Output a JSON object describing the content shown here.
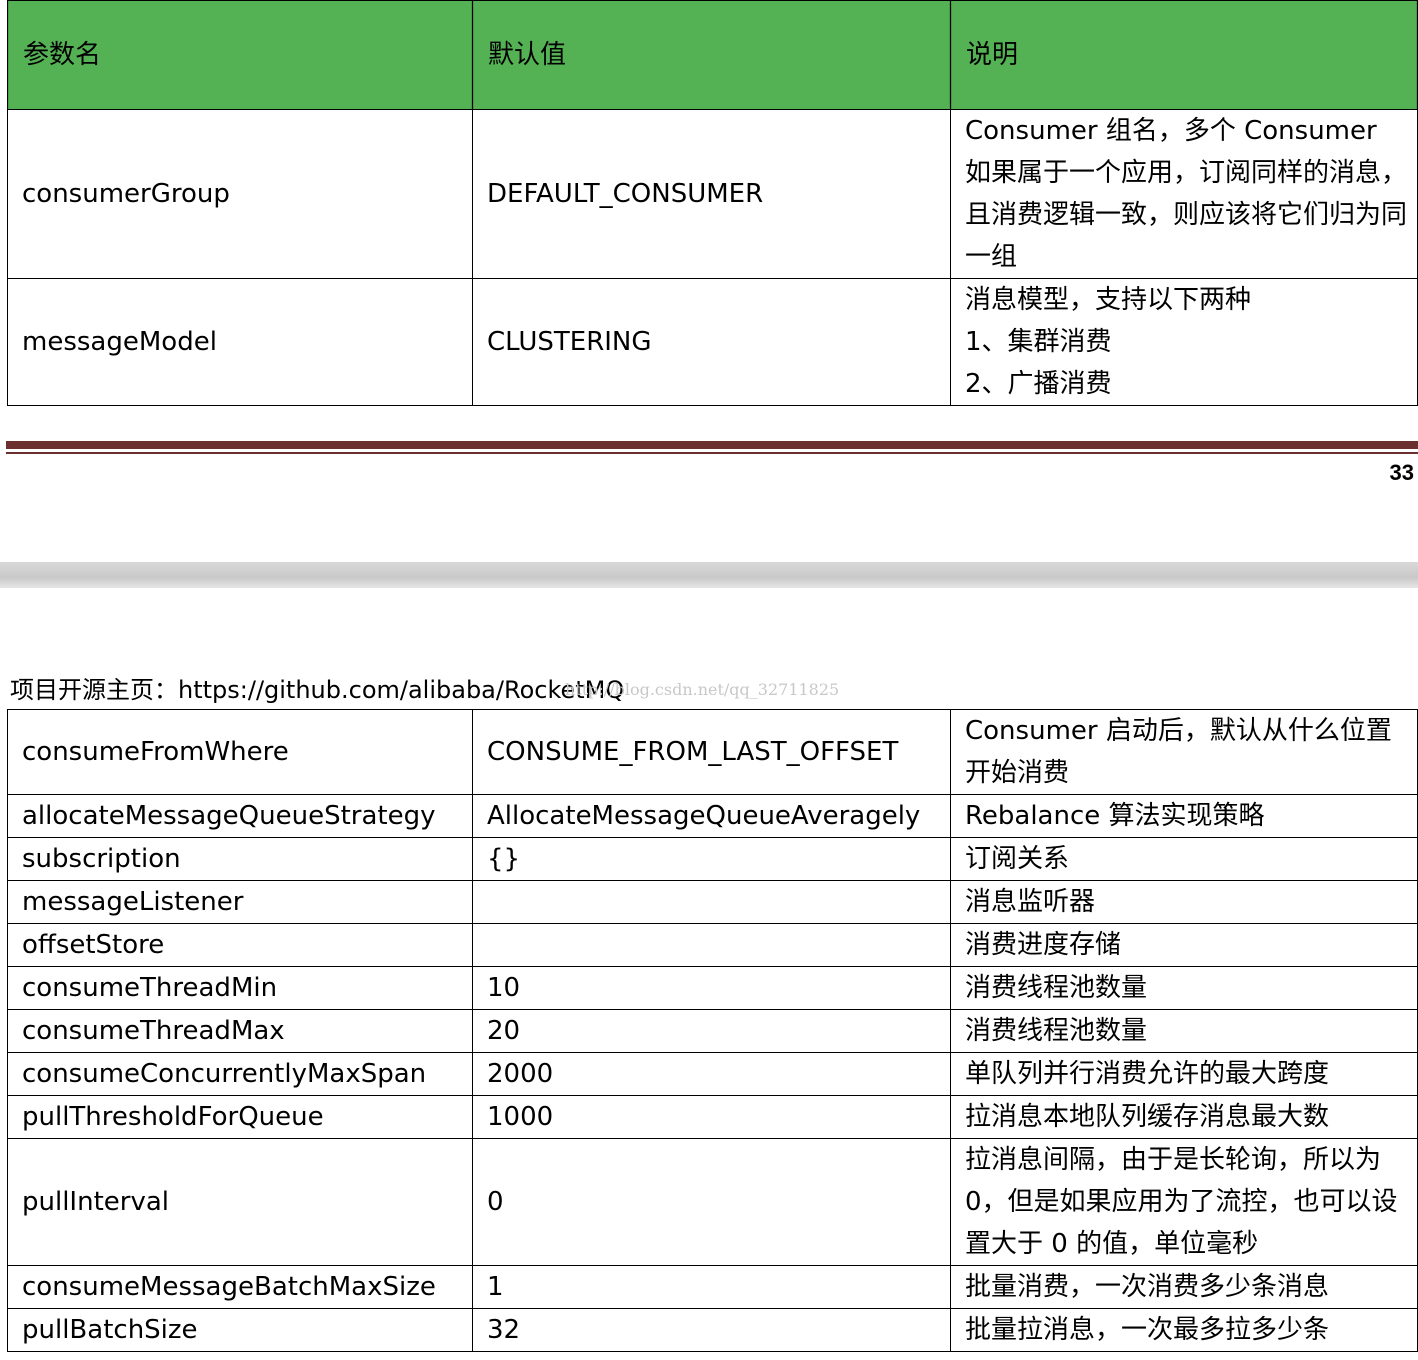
{
  "top_table": {
    "header": {
      "param": "参数名",
      "default": "默认值",
      "desc": "说明"
    },
    "rows": [
      {
        "param": "consumerGroup",
        "default": "DEFAULT_CONSUMER",
        "desc": "Consumer 组名，多个 Consumer 如果属于一个应用，订阅同样的消息，且消费逻辑一致，则应该将它们归为同一组"
      },
      {
        "param": "messageModel",
        "default": "CLUSTERING",
        "desc_lines": [
          "消息模型，支持以下两种",
          "1、集群消费",
          "2、广播消费"
        ]
      }
    ]
  },
  "page_number": "33",
  "header_line": "项目开源主页：https://github.com/alibaba/RocketMQ",
  "watermark": "http://blog.csdn.net/qq_32711825",
  "bottom_table": {
    "rows": [
      {
        "param": "consumeFromWhere",
        "default": "CONSUME_FROM_LAST_OFFSET",
        "desc": "Consumer 启动后，默认从什么位置开始消费"
      },
      {
        "param": "allocateMessageQueueStrategy",
        "default": "AllocateMessageQueueAveragely",
        "desc": "Rebalance 算法实现策略"
      },
      {
        "param": "subscription",
        "default": "{}",
        "desc": "订阅关系"
      },
      {
        "param": "messageListener",
        "default": "",
        "desc": "消息监听器"
      },
      {
        "param": "offsetStore",
        "default": "",
        "desc": "消费进度存储"
      },
      {
        "param": "consumeThreadMin",
        "default": "10",
        "desc": "消费线程池数量"
      },
      {
        "param": "consumeThreadMax",
        "default": "20",
        "desc": "消费线程池数量"
      },
      {
        "param": "consumeConcurrentlyMaxSpan",
        "default": "2000",
        "desc": "单队列并行消费允许的最大跨度"
      },
      {
        "param": "pullThresholdForQueue",
        "default": "1000",
        "desc": "拉消息本地队列缓存消息最大数"
      },
      {
        "param": "pullInterval",
        "default": "0",
        "desc": "拉消息间隔，由于是长轮询，所以为 0，但是如果应用为了流控，也可以设置大于 0 的值，单位毫秒"
      },
      {
        "param": "consumeMessageBatchMaxSize",
        "default": "1",
        "desc": "批量消费，一次消费多少条消息"
      },
      {
        "param": "pullBatchSize",
        "default": "32",
        "desc": "批量拉消息，一次最多拉多少条"
      }
    ]
  }
}
